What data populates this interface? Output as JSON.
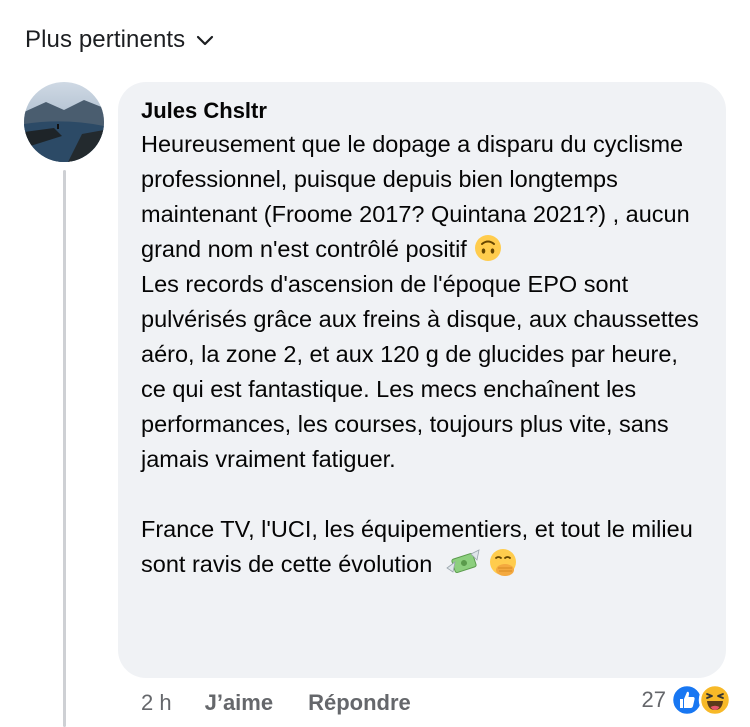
{
  "sort": {
    "label": "Plus pertinents",
    "icon": "chevron-down-icon"
  },
  "comment": {
    "author": "Jules Chsltr",
    "paragraphs": {
      "p1": "Heureusement que le dopage a disparu du cyclisme professionnel, puisque depuis bien longtemps maintenant (Froome 2017? Quintana 2021?) , aucun grand nom n'est contrôlé positif",
      "p2": "Les records d'ascension de l'époque EPO sont pulvérisés grâce aux freins à disque, aux chaussettes aéro, la zone 2, et aux 120 g de glucides par heure, ce qui est fantastique. Les mecs enchaînent les performances, les courses, toujours plus vite, sans jamais vraiment fatiguer.",
      "p3": "France TV, l'UCI, les équipementiers, et tout le milieu sont ravis de cette évolution"
    },
    "emojis": [
      "upside-down-face-icon",
      "money-with-wings-icon",
      "face-with-hand-over-mouth-icon"
    ],
    "time": "2 h",
    "like_label": "J’aime",
    "reply_label": "Répondre",
    "reaction_count": "27",
    "reaction_icons": [
      "like-reaction-icon",
      "haha-reaction-icon"
    ]
  },
  "colors": {
    "bubble": "#f0f2f5",
    "meta_text": "#65676b",
    "like_blue": "#1877f2",
    "haha_yellow": "#f7b928"
  }
}
